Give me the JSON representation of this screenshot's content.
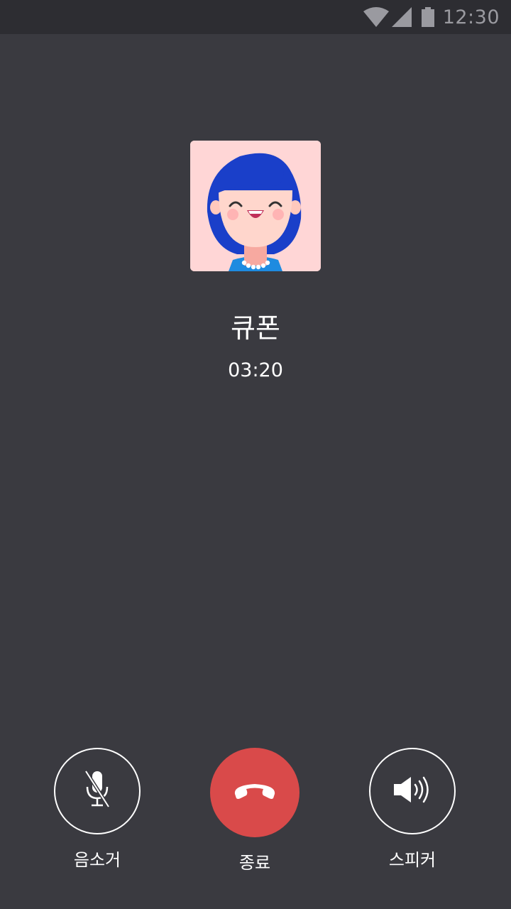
{
  "status_bar": {
    "time": "12:30",
    "icons": [
      "wifi-icon",
      "signal-icon",
      "battery-icon"
    ]
  },
  "call": {
    "caller_name": "큐폰",
    "duration": "03:20"
  },
  "controls": {
    "mute_label": "음소거",
    "end_label": "종료",
    "speaker_label": "스피커"
  },
  "colors": {
    "background": "#3a3a40",
    "status_bar": "#2d2d32",
    "end_call": "#d94a4a",
    "avatar_bg": "#ffd6d6",
    "hair": "#1a3fc9"
  }
}
